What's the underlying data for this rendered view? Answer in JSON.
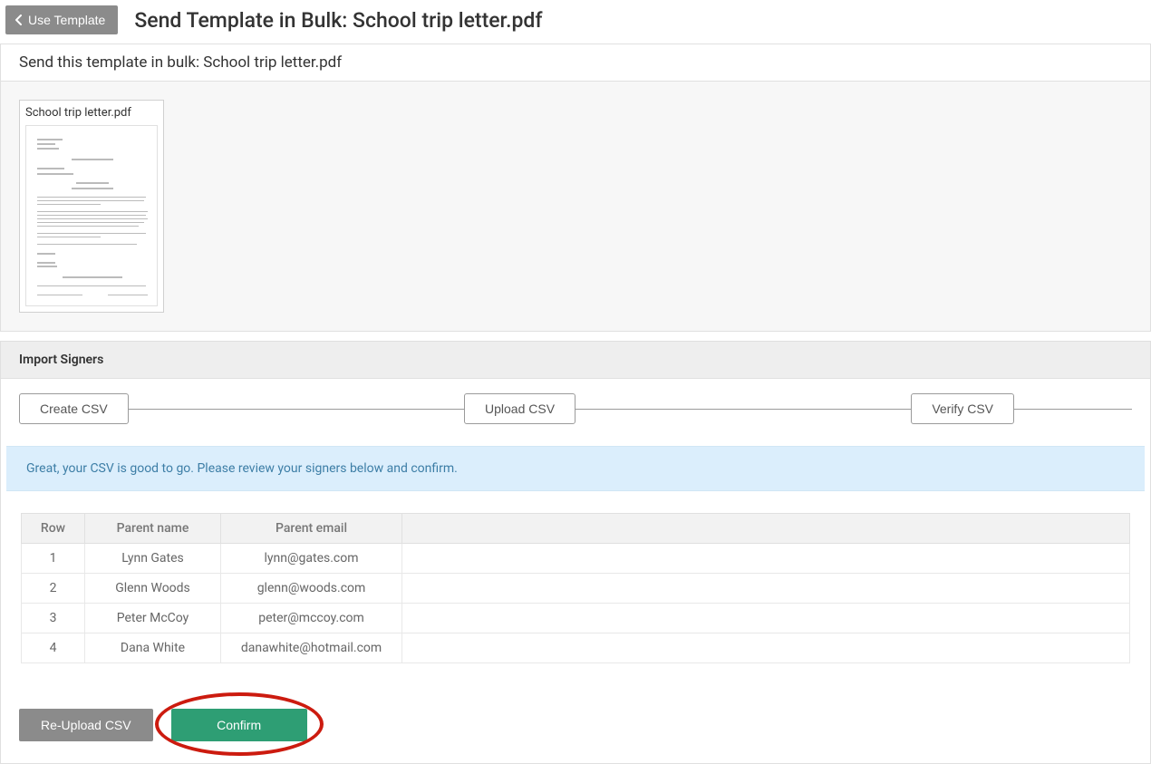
{
  "header": {
    "back_label": "Use Template",
    "title": "Send Template in Bulk: School trip letter.pdf"
  },
  "send_panel": {
    "heading": "Send this template in bulk: School trip letter.pdf",
    "thumb_label": "School trip letter.pdf"
  },
  "import": {
    "title": "Import Signers",
    "steps": {
      "create": "Create CSV",
      "upload": "Upload CSV",
      "verify": "Verify CSV"
    },
    "banner": "Great, your CSV is good to go. Please review your signers below and confirm.",
    "columns": {
      "row": "Row",
      "name": "Parent name",
      "email": "Parent email"
    },
    "rows": [
      {
        "row": "1",
        "name": "Lynn Gates",
        "email": "lynn@gates.com"
      },
      {
        "row": "2",
        "name": "Glenn Woods",
        "email": "glenn@woods.com"
      },
      {
        "row": "3",
        "name": "Peter McCoy",
        "email": "peter@mccoy.com"
      },
      {
        "row": "4",
        "name": "Dana White",
        "email": "danawhite@hotmail.com"
      }
    ],
    "actions": {
      "reupload": "Re-Upload CSV",
      "confirm": "Confirm"
    }
  }
}
